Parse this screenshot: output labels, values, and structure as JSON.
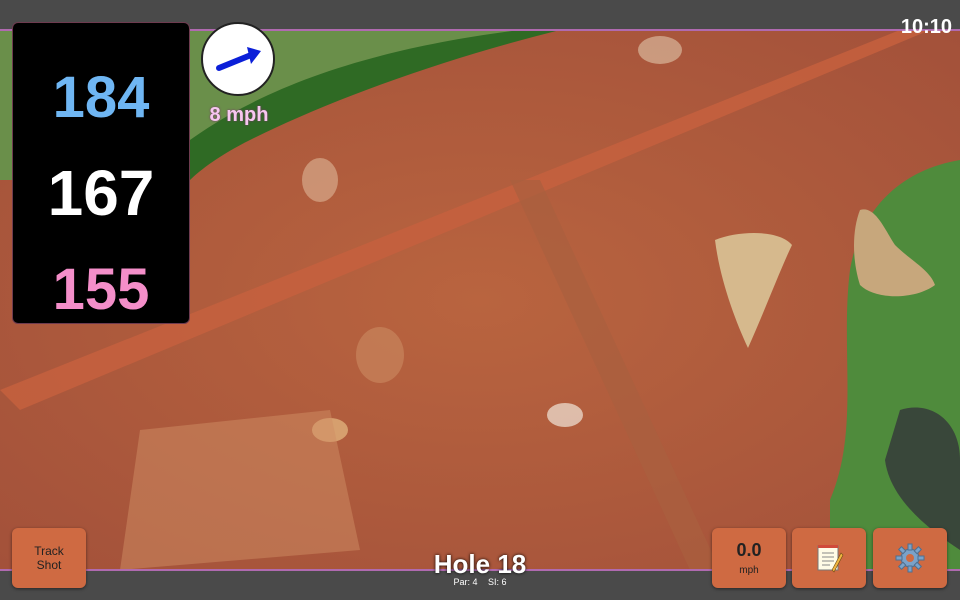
{
  "status": {
    "time": "10:10"
  },
  "distances": {
    "back": "184",
    "middle": "167",
    "front": "155"
  },
  "wind": {
    "speed_text": "8 mph",
    "direction_icon": "arrow-icon"
  },
  "hole": {
    "title": "Hole 18",
    "par": "Par: 4",
    "si": "SI: 6"
  },
  "buttons": {
    "track_shot_line1": "Track",
    "track_shot_line2": "Shot",
    "speed_value": "0.0",
    "speed_unit": "mph",
    "notes_icon": "notepad-icon",
    "settings_icon": "gear-icon"
  },
  "colors": {
    "back": "#6fb6f3",
    "middle": "#ffffff",
    "front": "#f48ec9",
    "button": "#cf6a42",
    "accent_line": "#b06ab0"
  }
}
